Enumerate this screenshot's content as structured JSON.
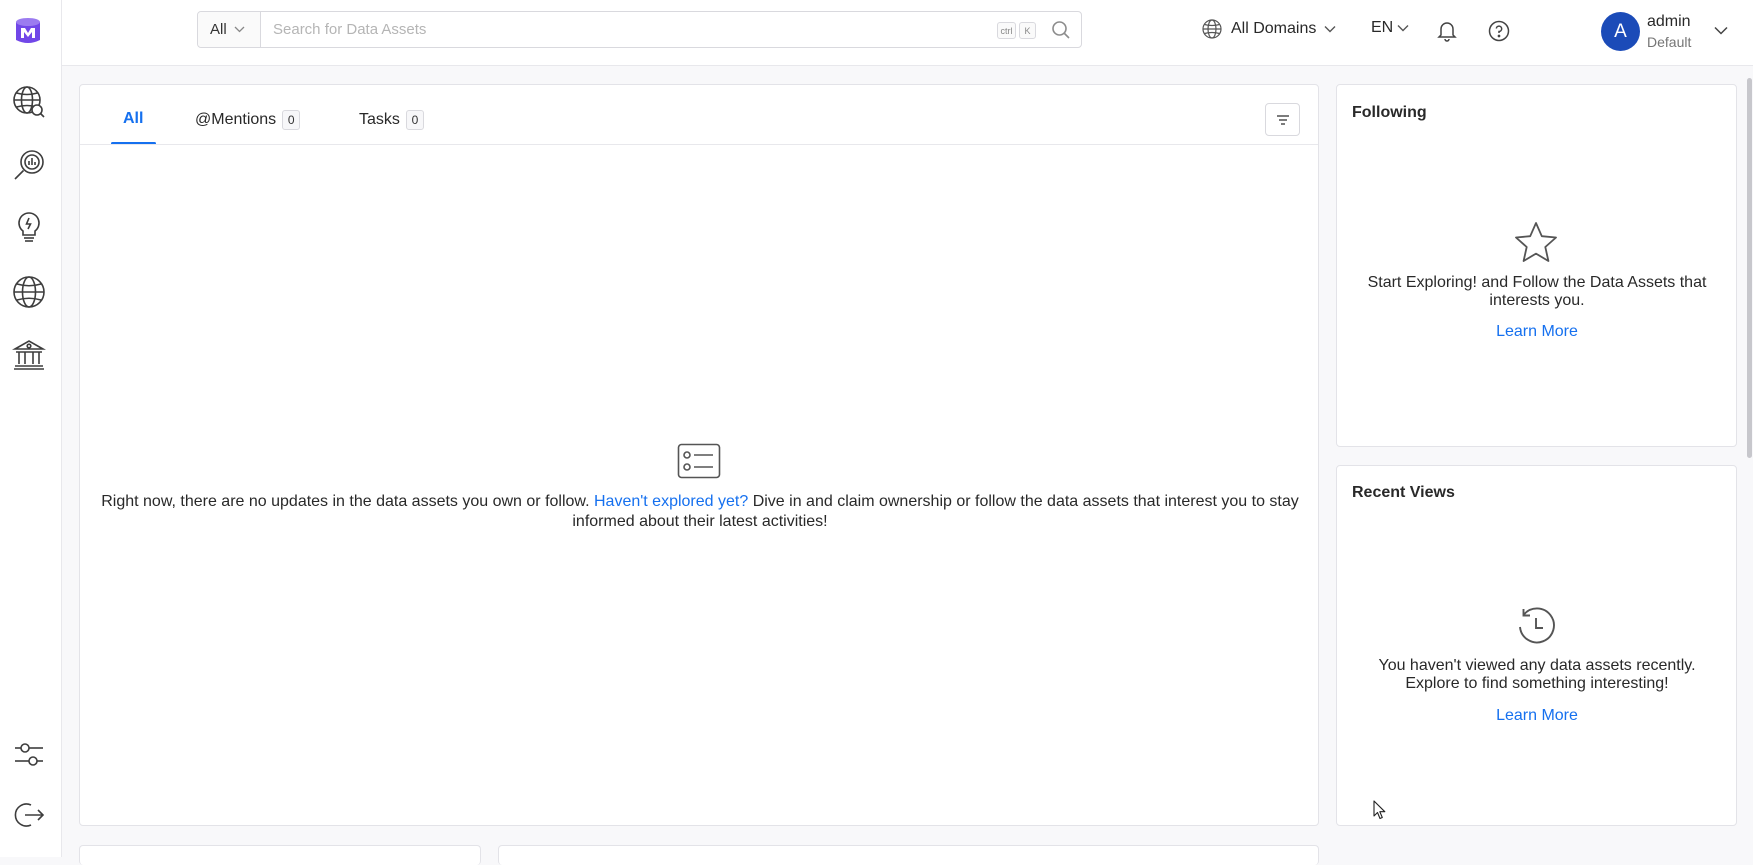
{
  "search": {
    "category": "All",
    "placeholder": "Search for Data Assets",
    "shortcut_ctrl": "ctrl",
    "shortcut_key": "K"
  },
  "header": {
    "domain": "All Domains",
    "language": "EN",
    "user_initial": "A",
    "user_name": "admin",
    "user_role": "Default"
  },
  "feed": {
    "tabs": [
      {
        "label": "All",
        "count": null,
        "active": true
      },
      {
        "label": "@Mentions",
        "count": "0",
        "active": false
      },
      {
        "label": "Tasks",
        "count": "0",
        "active": false
      }
    ],
    "empty_text_before": "Right now, there are no updates in the data assets you own or follow. ",
    "empty_link": "Haven't explored yet?",
    "empty_text_after": " Dive in and claim ownership or follow the data assets that interest you to stay informed about their latest activities!"
  },
  "following": {
    "title": "Following",
    "message": "Start Exploring! and Follow the Data Assets that interests you.",
    "link": "Learn More"
  },
  "recent_views": {
    "title": "Recent Views",
    "message": "You haven't viewed any data assets recently. Explore to find something interesting!",
    "link": "Learn More"
  },
  "colors": {
    "accent": "#1570ef",
    "brand": "#7147e8",
    "avatar": "#1b4bb8"
  }
}
